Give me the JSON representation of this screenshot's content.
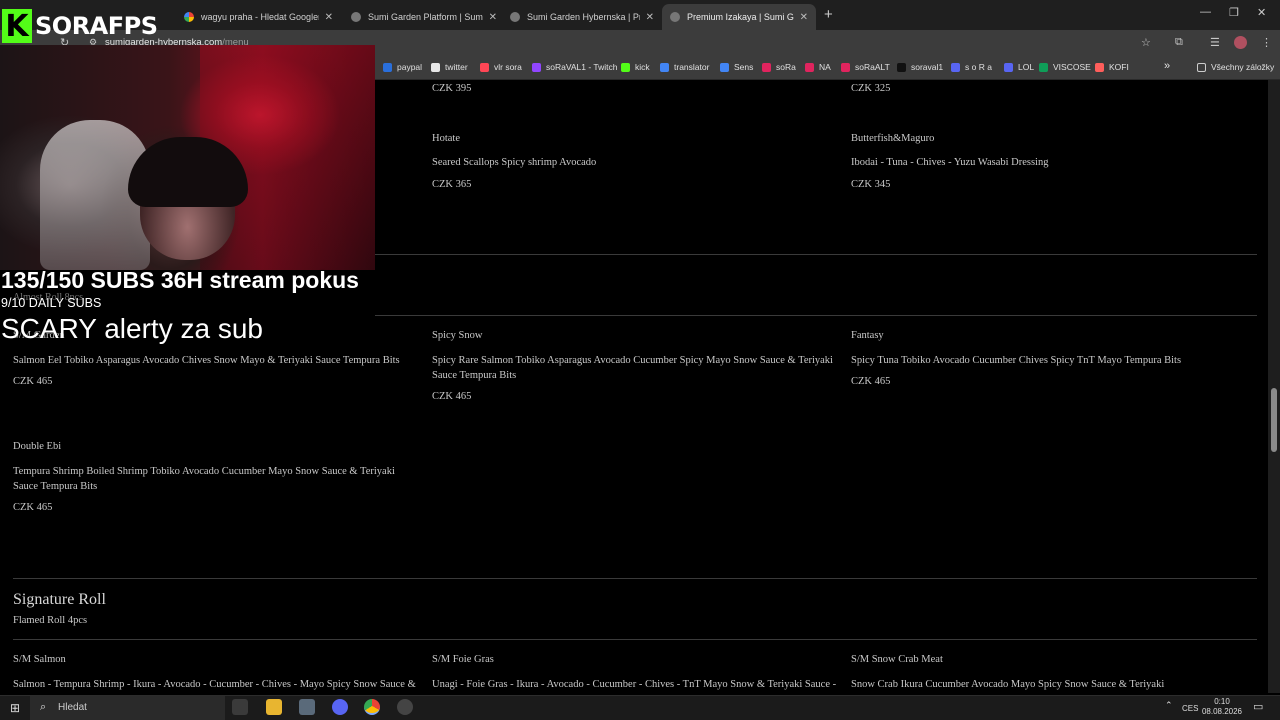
{
  "browser": {
    "tabs": [
      {
        "title": "",
        "active": false
      },
      {
        "title": "wagyu praha - Hledat Googlem",
        "active": false
      },
      {
        "title": "Sumi Garden Platform | Sumi G",
        "active": false
      },
      {
        "title": "Sumi Garden Hybernska | Prem",
        "active": false
      },
      {
        "title": "Premium Izakaya | Sumi Garden",
        "active": true
      }
    ],
    "new_tab": "+",
    "address": {
      "host": "sumigarden-hybernska.com",
      "path": "/menu"
    },
    "bookmarks": [
      {
        "label": "paypal",
        "color": "#2a6fdb"
      },
      {
        "label": "twitter",
        "color": "#e7e7e7"
      },
      {
        "label": "vlr sora",
        "color": "#ff4655"
      },
      {
        "label": "soRaVAL1 - Twitch",
        "color": "#9146ff"
      },
      {
        "label": "kick",
        "color": "#53fc18"
      },
      {
        "label": "translator",
        "color": "#4285f4"
      },
      {
        "label": "Sens",
        "color": "#4285f4"
      },
      {
        "label": "soRa",
        "color": "#e0245e"
      },
      {
        "label": "NA",
        "color": "#e0245e"
      },
      {
        "label": "soRaALT",
        "color": "#e0245e"
      },
      {
        "label": "soraval1",
        "color": "#111111"
      },
      {
        "label": "s o R a",
        "color": "#5865f2"
      },
      {
        "label": "LOL",
        "color": "#5865f2"
      },
      {
        "label": "VISCOSE",
        "color": "#0f9d58"
      },
      {
        "label": "KOFI",
        "color": "#ff5e5b"
      }
    ],
    "bookmarks_more": "»",
    "all_bookmarks": "Všechny záložky"
  },
  "menu": {
    "top_prices": {
      "left": "CZK 395",
      "right": "CZK 325"
    },
    "items_top": [
      {
        "name": "Hotate",
        "desc": "Seared Scallops Spicy shrimp Avocado",
        "price": "CZK 365"
      },
      {
        "name": "Butterfish&Maguro",
        "desc": "Ibodai - Tuna - Chives - Yuzu Wasabi Dressing",
        "price": "CZK 345"
      }
    ],
    "hidden_section_title": "Almost Roll 8pcs",
    "row1": [
      {
        "name": "S/M Garden",
        "desc": "Salmon Eel Tobiko Asparagus Avocado Chives Snow Mayo & Teriyaki Sauce Tempura Bits",
        "price": "CZK 465"
      },
      {
        "name": "Spicy Snow",
        "desc": "Spicy Rare Salmon Tobiko Asparagus Avocado Cucumber Spicy Mayo Snow Sauce & Teriyaki Sauce Tempura Bits",
        "price": "CZK 465"
      },
      {
        "name": "Fantasy",
        "desc": "Spicy Tuna Tobiko Avocado Cucumber Chives Spicy TnT Mayo Tempura Bits",
        "price": "CZK 465"
      }
    ],
    "row2": [
      {
        "name": "Double Ebi",
        "desc": "Tempura Shrimp Boiled Shrimp Tobiko Avocado Cucumber Mayo Snow Sauce & Teriyaki Sauce Tempura Bits",
        "price": "CZK 465"
      }
    ],
    "signature": {
      "title": "Signature Roll",
      "subtitle": "Flamed Roll 4pcs"
    },
    "row3": [
      {
        "name": "S/M Salmon",
        "desc": "Salmon - Tempura Shrimp - Ikura - Avocado - Cucumber - Chives - Mayo Spicy Snow Sauce &"
      },
      {
        "name": "S/M Foie Gras",
        "desc": "Unagi - Foie Gras - Ikura - Avocado - Cucumber - Chives - TnT Mayo Snow & Teriyaki Sauce -"
      },
      {
        "name": "S/M Snow Crab Meat",
        "desc": "Snow Crab Ikura Cucumber Avocado Mayo Spicy Snow Sauce & Teriyaki"
      }
    ]
  },
  "overlay": {
    "brand": "SORAFPS",
    "brand_k": "K",
    "subs": "135/150  SUBS  36H stream pokus",
    "daily": "9/10 DAILY SUBS",
    "scary": "SCARY alerty za sub"
  },
  "taskbar": {
    "search": "Hledat",
    "lang": "CES",
    "time": "0:10",
    "date": "08.08.2026"
  }
}
